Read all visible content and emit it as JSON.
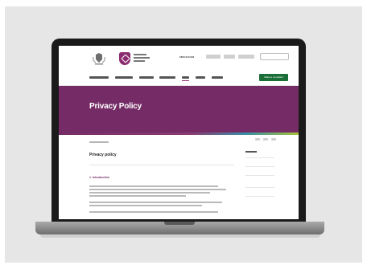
{
  "site": {
    "phone": "1800 019 634",
    "cta_label": "Make a complaint"
  },
  "hero": {
    "title": "Privacy Policy"
  },
  "content": {
    "page_heading": "Privacy policy",
    "section_heading": "1. Introduction"
  },
  "colors": {
    "brand_purple": "#752c66",
    "cta_green": "#1a6e37",
    "laptop_bezel": "#1a1a1a"
  },
  "icons": [
    "coat-of-arms-icon",
    "shield-logo-icon",
    "search-icon",
    "share-icon"
  ]
}
